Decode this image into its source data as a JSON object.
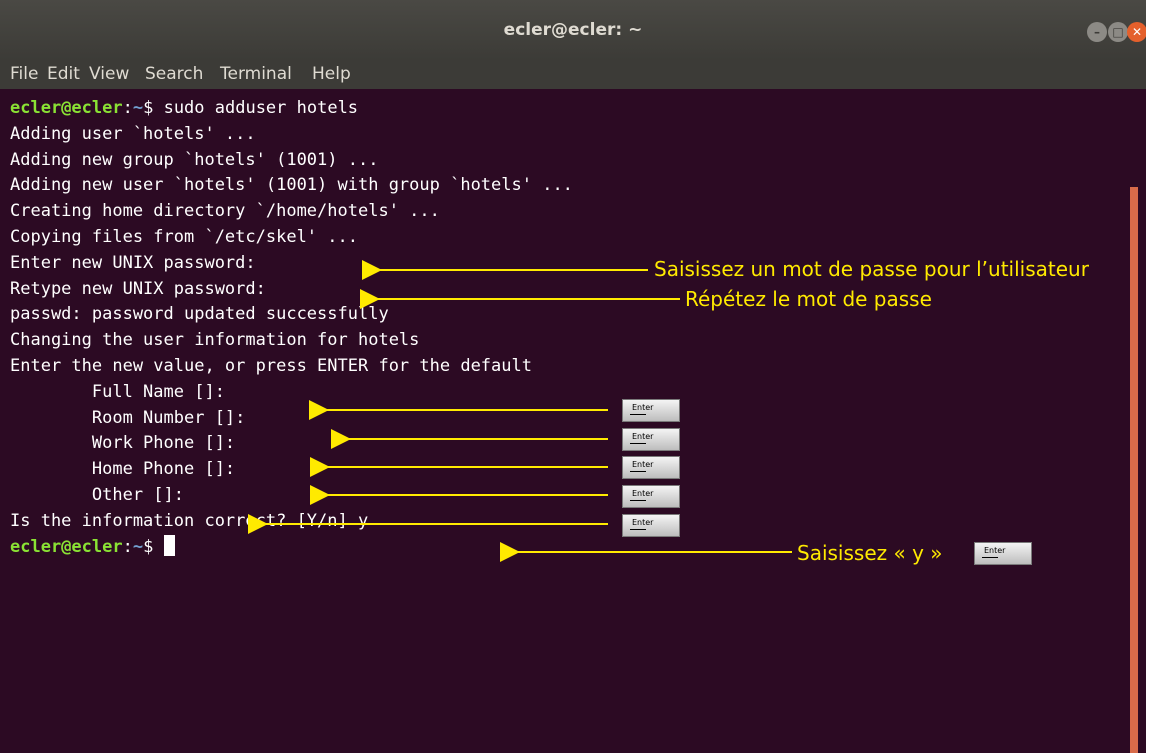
{
  "window": {
    "title": "ecler@ecler: ~"
  },
  "menu": [
    "File",
    "Edit",
    "View",
    "Search",
    "Terminal",
    "Help"
  ],
  "prompt": {
    "user_host": "ecler@ecler",
    "path": "~",
    "symbol": "$"
  },
  "terminal_lines": [
    {
      "type": "command",
      "cmd": " sudo adduser hotels"
    },
    {
      "type": "text",
      "text": "Adding user `hotels' ..."
    },
    {
      "type": "text",
      "text": "Adding new group `hotels' (1001) ..."
    },
    {
      "type": "text",
      "text": "Adding new user `hotels' (1001) with group `hotels' ..."
    },
    {
      "type": "text",
      "text": "Creating home directory `/home/hotels' ..."
    },
    {
      "type": "text",
      "text": "Copying files from `/etc/skel' ..."
    },
    {
      "type": "text",
      "text": "Enter new UNIX password:"
    },
    {
      "type": "text",
      "text": "Retype new UNIX password:"
    },
    {
      "type": "text",
      "text": "passwd: password updated successfully"
    },
    {
      "type": "text",
      "text": "Changing the user information for hotels"
    },
    {
      "type": "text",
      "text": "Enter the new value, or press ENTER for the default"
    },
    {
      "type": "text",
      "text": "\tFull Name []:"
    },
    {
      "type": "text",
      "text": "\tRoom Number []:"
    },
    {
      "type": "text",
      "text": "\tWork Phone []:"
    },
    {
      "type": "text",
      "text": "\tHome Phone []:"
    },
    {
      "type": "text",
      "text": "\tOther []:"
    },
    {
      "type": "text",
      "text": "Is the information correct? [Y/n] y"
    },
    {
      "type": "prompt_cursor",
      "cmd": " "
    }
  ],
  "annotations": {
    "arrow_color": "#ffea00",
    "password_note": "Saisissez un mot de passe pour l’utilisateur",
    "retype_note": "Répétez le mot de passe",
    "confirm_note": "Saisissez « y »",
    "enter_key_label": "Enter"
  }
}
